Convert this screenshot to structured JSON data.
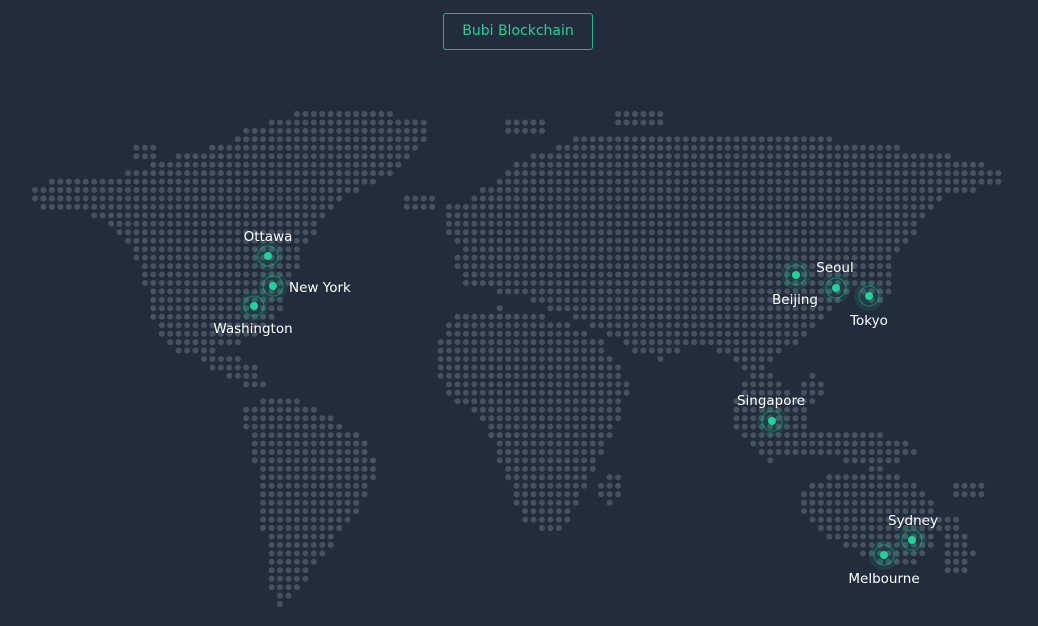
{
  "header": {
    "brand_label": "Bubi Blockchain"
  },
  "colors": {
    "background": "#232c3c",
    "land_dot": "#475161",
    "accent": "#1fd39a"
  },
  "cities": [
    {
      "name": "Ottawa"
    },
    {
      "name": "New York"
    },
    {
      "name": "Washington"
    },
    {
      "name": "Beijing"
    },
    {
      "name": "Seoul"
    },
    {
      "name": "Tokyo"
    },
    {
      "name": "Singapore"
    },
    {
      "name": "Sydney"
    },
    {
      "name": "Melbourne"
    }
  ]
}
